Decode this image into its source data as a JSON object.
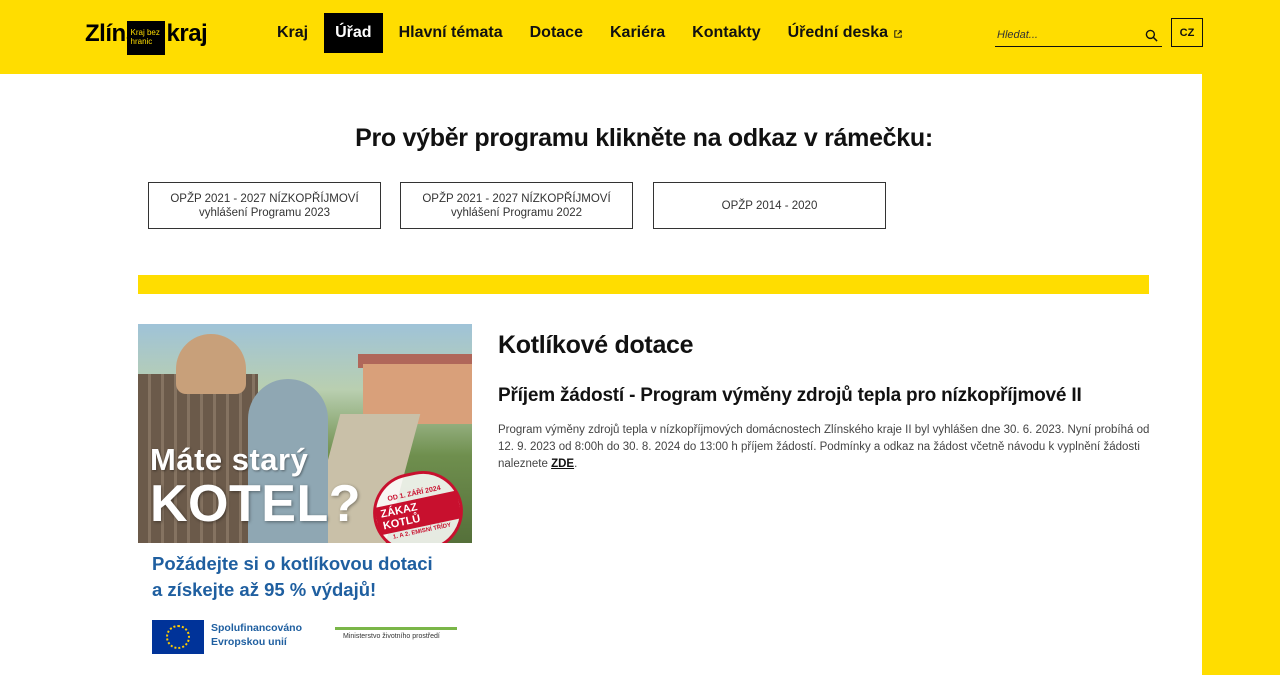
{
  "header": {
    "logo": {
      "word1": "Zlíns",
      "badge_line1": "Kraj bez",
      "badge_line2": "hranic",
      "word2": "kraj"
    },
    "nav": [
      {
        "label": "Kraj",
        "active": false
      },
      {
        "label": "Úřad",
        "active": true
      },
      {
        "label": "Hlavní témata",
        "active": false
      },
      {
        "label": "Dotace",
        "active": false
      },
      {
        "label": "Kariéra",
        "active": false
      },
      {
        "label": "Kontakty",
        "active": false
      },
      {
        "label": "Úřední deska",
        "active": false,
        "external": true
      }
    ],
    "search": {
      "placeholder": "Hledat..."
    },
    "language": "CZ"
  },
  "main": {
    "headline": "Pro výběr programu klikněte na odkaz v rámečku:",
    "programs": [
      {
        "line1": "OPŽP 2021 - 2027 NÍZKOPŘÍJMOVÍ",
        "line2": "vyhlášení Programu 2023"
      },
      {
        "line1": "OPŽP 2021 - 2027 NÍZKOPŘÍJMOVÍ",
        "line2": "vyhlášení Programu 2022"
      },
      {
        "line1": "OPŽP 2014 - 2020",
        "line2": ""
      }
    ],
    "banner": {
      "text_line1": "Máte starý",
      "text_line2": "KOTEL?",
      "stamp_top": "OD 1. ZÁŘÍ 2024",
      "stamp_main": "ZÁKAZ KOTLŮ",
      "stamp_bottom": "1. A 2. EMISNÍ TŘÍDY",
      "slogan_line1": "Požádejte si o kotlíkovou dotaci",
      "slogan_line2": "a získejte až 95 % výdajů!",
      "eu_line1": "Spolufinancováno",
      "eu_line2": "Evropskou unií",
      "ministry": "Ministerstvo životního prostředí"
    },
    "article": {
      "title": "Kotlíkové dotace",
      "subtitle": "Příjem žádostí - Program výměny zdrojů tepla pro nízkopříjmové II",
      "body": "Program výměny zdrojů tepla v nízkopříjmových domácnostech Zlínského kraje II byl vyhlášen dne 30. 6. 2023. Nyní probíhá od 12. 9. 2023 od 8:00h do 30. 8. 2024 do 13:00 h příjem žádostí. Podmínky a odkaz na žádost včetně návodu k vyplnění žádosti naleznete ",
      "link": "ZDE",
      "body_end": "."
    }
  },
  "colors": {
    "brand_yellow": "#ffdd00",
    "eu_blue": "#003399",
    "slogan_blue": "#1f5fa0",
    "stamp_red": "#c8102e"
  }
}
